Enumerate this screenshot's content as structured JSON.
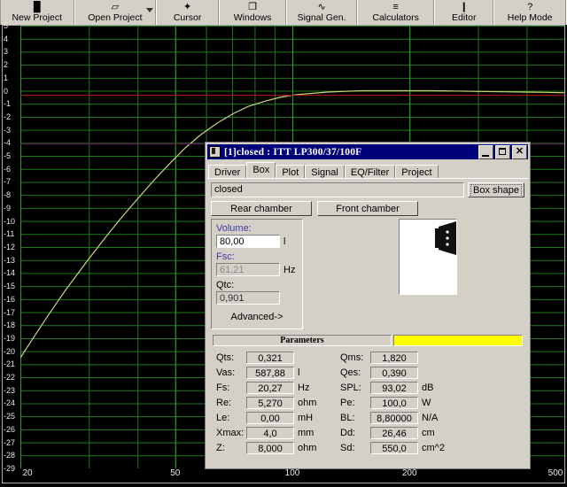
{
  "toolbar": {
    "buttons": [
      {
        "label": "New Project",
        "icon": "document-icon",
        "caret": false
      },
      {
        "label": "Open Project",
        "icon": "folder-open-icon",
        "caret": true
      },
      {
        "label": "Cursor",
        "icon": "crosshair-icon",
        "caret": false
      },
      {
        "label": "Windows",
        "icon": "windows-icon",
        "caret": false
      },
      {
        "label": "Signal Gen.",
        "icon": "waveform-icon",
        "caret": false
      },
      {
        "label": "Calculators",
        "icon": "sliders-icon",
        "caret": false
      },
      {
        "label": "Editor",
        "icon": "pencil-icon",
        "caret": false
      },
      {
        "label": "Help Mode",
        "icon": "question-mark-icon",
        "caret": false
      }
    ]
  },
  "chart_data": {
    "type": "line",
    "title": "",
    "xlabel": "",
    "ylabel": "",
    "xscale": "log",
    "xlim": [
      20,
      500
    ],
    "ylim": [
      -29,
      5
    ],
    "grid": true,
    "xticks": [
      20,
      50,
      100,
      200,
      500
    ],
    "yticks": [
      5,
      4,
      3,
      2,
      1,
      0,
      -1,
      -2,
      -3,
      -4,
      -5,
      -6,
      -7,
      -8,
      -9,
      -10,
      -11,
      -12,
      -13,
      -14,
      -15,
      -16,
      -17,
      -18,
      -19,
      -20,
      -21,
      -22,
      -23,
      -24,
      -25,
      -26,
      -27,
      -28,
      -29
    ],
    "background": "#000000",
    "gridcolor": "#1e7a1e",
    "series": [
      {
        "name": "system-response",
        "color": "#cdd47a",
        "x": [
          20,
          22,
          24,
          26,
          28,
          30,
          33,
          36,
          40,
          44,
          48,
          53,
          58,
          64,
          70,
          77,
          85,
          93,
          102,
          112,
          123,
          135,
          150,
          165,
          180,
          200,
          230,
          260,
          300,
          350,
          400,
          450,
          500
        ],
        "y": [
          -20.5,
          -18.6,
          -16.9,
          -15.4,
          -14.1,
          -12.9,
          -11.3,
          -9.9,
          -8.3,
          -6.9,
          -5.7,
          -4.4,
          -3.4,
          -2.5,
          -1.8,
          -1.2,
          -0.8,
          -0.5,
          -0.3,
          -0.2,
          -0.1,
          -0.05,
          0.0,
          0.0,
          0.0,
          0.0,
          0.0,
          -0.02,
          -0.05,
          -0.08,
          -0.1,
          -0.12,
          -0.15
        ]
      },
      {
        "name": "reference-line-red",
        "color": "#aa1a10",
        "x": [
          20,
          500
        ],
        "y": [
          -0.35,
          -0.35
        ]
      },
      {
        "name": "reference-line-magenta",
        "color": "#5a0a5a",
        "x": [
          20,
          500
        ],
        "y": [
          -4.1,
          -4.1
        ]
      }
    ]
  },
  "dialog": {
    "title": "[1]closed : ITT LP300/37/100F",
    "window_buttons": {
      "minimize": "minimize-icon",
      "maximize": "maximize-icon",
      "close": "close-icon"
    },
    "tabs": [
      {
        "label": "Driver",
        "active": false
      },
      {
        "label": "Box",
        "active": true
      },
      {
        "label": "Plot",
        "active": false
      },
      {
        "label": "Signal",
        "active": false
      },
      {
        "label": "EQ/Filter",
        "active": false
      },
      {
        "label": "Project",
        "active": false
      }
    ],
    "box_tab": {
      "name_value": "closed",
      "box_shape_button": "Box shape",
      "rear_chamber_button": "Rear chamber",
      "front_chamber_button": "Front chamber",
      "volume_label": "Volume:",
      "volume_value": "80,00",
      "volume_unit": "l",
      "fsc_label": "Fsc:",
      "fsc_value": "61,21",
      "fsc_unit": "Hz",
      "qtc_label": "Qtc:",
      "qtc_value": "0,901",
      "advanced_button": "Advanced->"
    },
    "parameters": {
      "header": "Parameters",
      "left": [
        {
          "name": "Qts:",
          "value": "0,321",
          "unit": ""
        },
        {
          "name": "Vas:",
          "value": "587,88",
          "unit": "l"
        },
        {
          "name": "Fs:",
          "value": "20,27",
          "unit": "Hz"
        },
        {
          "name": "Re:",
          "value": "5,270",
          "unit": "ohm"
        },
        {
          "name": "Le:",
          "value": "0,00",
          "unit": "mH"
        },
        {
          "name": "Xmax:",
          "value": "4,0",
          "unit": "mm"
        },
        {
          "name": "Z:",
          "value": "8,000",
          "unit": "ohm"
        }
      ],
      "right": [
        {
          "name": "Qms:",
          "value": "1,820",
          "unit": ""
        },
        {
          "name": "Qes:",
          "value": "0,390",
          "unit": ""
        },
        {
          "name": "SPL:",
          "value": "93,02",
          "unit": "dB"
        },
        {
          "name": "Pe:",
          "value": "100,0",
          "unit": "W"
        },
        {
          "name": "BL:",
          "value": "8,80000",
          "unit": "N/A"
        },
        {
          "name": "Dd:",
          "value": "26,46",
          "unit": "cm"
        },
        {
          "name": "Sd:",
          "value": "550,0",
          "unit": "cm^2"
        }
      ]
    }
  },
  "colors": {
    "titlebar": "#00007b",
    "face": "#d4d0c8",
    "highlight_yellow": "#ffff00",
    "plot_bg": "#000000",
    "grid": "#1e7a1e"
  }
}
